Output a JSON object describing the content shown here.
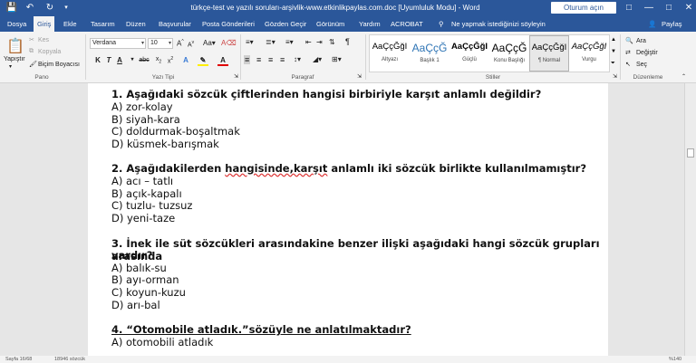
{
  "title_bar": {
    "doc_title": "türkçe-test ve yazılı soruları-arşivlik-www.etkinlikpaylas.com.doc [Uyumluluk Modu] - Word",
    "sign_in": "Oturum açın"
  },
  "tabs": [
    "Dosya",
    "Giriş",
    "Ekle",
    "Tasarım",
    "Düzen",
    "Başvurular",
    "Posta Gönderileri",
    "Gözden Geçir",
    "Görünüm",
    "Yardım",
    "ACROBAT"
  ],
  "tell_me": "Ne yapmak istediğinizi söyleyin",
  "share": "Paylaş",
  "clipboard": {
    "paste": "Yapıştır",
    "cut": "Kes",
    "copy": "Kopyala",
    "format_painter": "Biçim Boyacısı",
    "label": "Pano"
  },
  "font": {
    "name": "Verdana",
    "size": "10",
    "label": "Yazı Tipi"
  },
  "paragraph": {
    "label": "Paragraf"
  },
  "styles": {
    "label": "Stiller",
    "items": [
      {
        "sample": "AaÇçĞğI",
        "name": "Altyazı"
      },
      {
        "sample": "AaÇçĞ",
        "name": "Başlık 1"
      },
      {
        "sample": "AaÇçĞğI",
        "name": "Güçlü"
      },
      {
        "sample": "AaÇçĞ",
        "name": "Konu Başlığı"
      },
      {
        "sample": "AaÇçĞğI",
        "name": "¶ Normal"
      },
      {
        "sample": "AaÇçĞğI",
        "name": "Vurgu"
      }
    ]
  },
  "editing": {
    "find": "Ara",
    "replace": "Değiştir",
    "select": "Seç",
    "label": "Düzenleme"
  },
  "document": {
    "q1": {
      "title": "1. Aşağıdaki sözcük çiftlerinden hangisi birbiriyle karşıt anlamlı değildir?",
      "options": [
        "A) zor-kolay",
        "B) siyah-kara",
        "C) doldurmak-boşaltmak",
        "D) küsmek-barışmak"
      ]
    },
    "q2": {
      "title_start": "2. Aşağıdakilerden ",
      "title_underlined": "hangisinde,karşıt",
      "title_end": " anlamlı iki sözcük birlikte kullanılmamıştır?",
      "options": [
        "A) acı – tatlı",
        "B) açık-kapalı",
        "C) tuzlu- tuzsuz",
        "D) yeni-taze"
      ]
    },
    "q3": {
      "title_line1": "3. İnek ile süt sözcükleri arasındakine benzer ilişki aşağıdaki hangi sözcük grupları arasında",
      "title_line2": "vardır?",
      "options": [
        "A) balık-su",
        "B) ayı-orman",
        "C) koyun-kuzu",
        "D) arı-bal"
      ]
    },
    "q4": {
      "title": "4. “Otomobile atladık.”sözüyle ne anlatılmaktadır?",
      "options": [
        "A) otomobili atladık"
      ]
    }
  },
  "status": {
    "page": "Sayfa 16/68",
    "words": "18946 sözcük",
    "zoom": "%140"
  }
}
